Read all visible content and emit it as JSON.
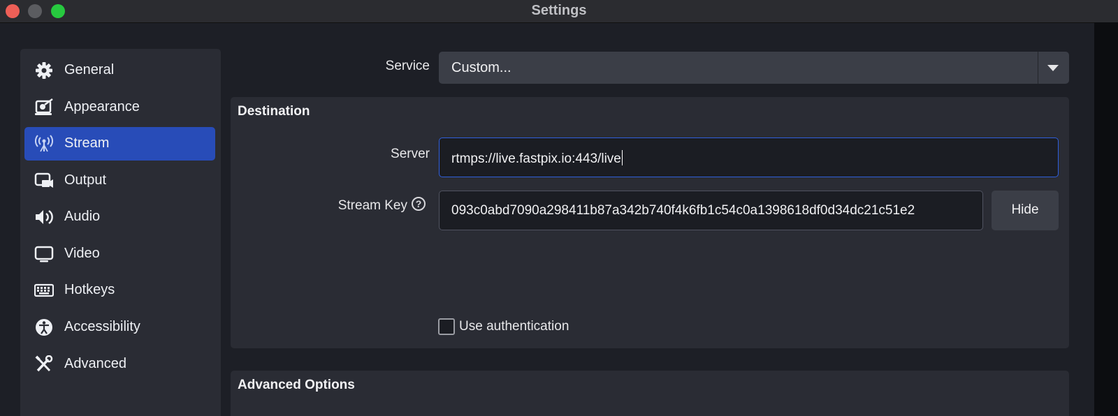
{
  "window": {
    "title": "Settings"
  },
  "sidebar": {
    "items": [
      {
        "label": "General",
        "icon": "gear-icon"
      },
      {
        "label": "Appearance",
        "icon": "appearance-icon"
      },
      {
        "label": "Stream",
        "icon": "antenna-icon",
        "active": true
      },
      {
        "label": "Output",
        "icon": "output-icon"
      },
      {
        "label": "Audio",
        "icon": "speaker-icon"
      },
      {
        "label": "Video",
        "icon": "monitor-icon"
      },
      {
        "label": "Hotkeys",
        "icon": "keyboard-icon"
      },
      {
        "label": "Accessibility",
        "icon": "accessibility-icon"
      },
      {
        "label": "Advanced",
        "icon": "tools-icon"
      }
    ]
  },
  "service": {
    "label": "Service",
    "value": "Custom..."
  },
  "destination": {
    "title": "Destination",
    "server_label": "Server",
    "server_value": "rtmps://live.fastpix.io:443/live",
    "stream_key_label": "Stream Key",
    "stream_key_value": "093c0abd7090a298411b87a342b740f4k6fb1c54c0a1398618df0d34dc21c51e2",
    "hide_label": "Hide",
    "auth_label": "Use authentication",
    "auth_checked": false
  },
  "advanced_options": {
    "title": "Advanced Options"
  },
  "colors": {
    "accent": "#284cb8",
    "focus": "#2f5fdc",
    "panel": "#2a2c34",
    "background": "#1d1f26"
  }
}
